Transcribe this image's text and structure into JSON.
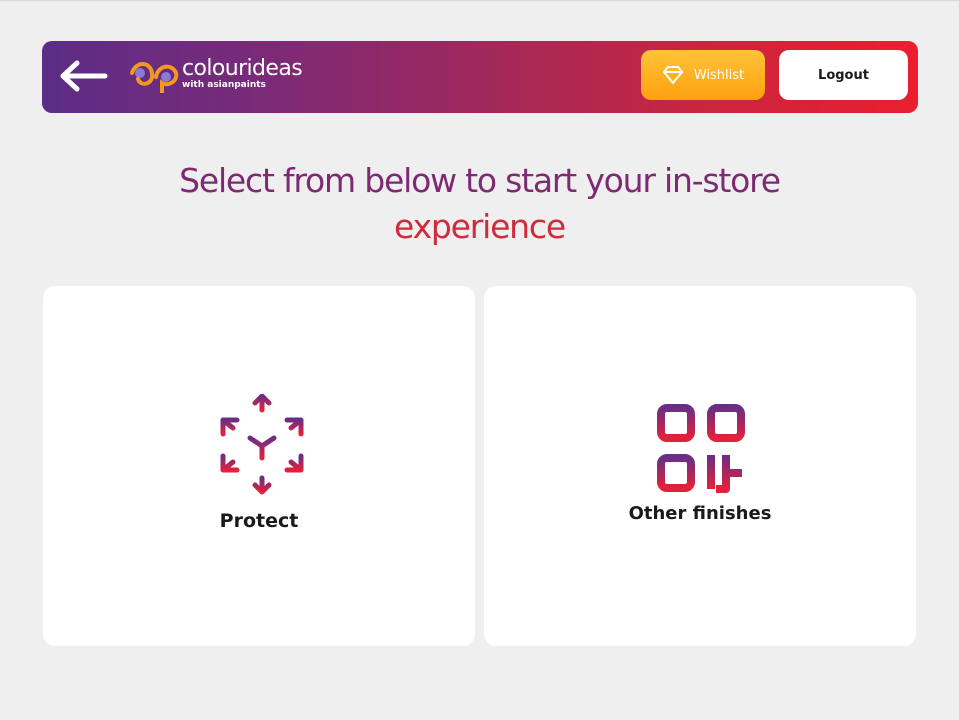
{
  "header": {
    "back_icon": "arrow-left-icon",
    "logo": {
      "brand": "colourideas",
      "tagline": "with asianpaints"
    },
    "wishlist": {
      "label": "Wishlist",
      "icon": "diamond-icon"
    },
    "logout": {
      "label": "Logout"
    },
    "gradient": [
      "#5b2d86",
      "#ea1f2f"
    ]
  },
  "main": {
    "heading_line1": "Select from below to start your in-store",
    "heading_line2": "experience",
    "options": [
      {
        "label": "Protect",
        "icon": "cube-arrows-icon"
      },
      {
        "label": "Other finishes",
        "icon": "qr-code-icon"
      }
    ]
  },
  "colors": {
    "background": "#efefef",
    "heading_purple": "#7e2a72",
    "heading_red": "#d02a3d",
    "wishlist_orange": "#ffa10f"
  }
}
